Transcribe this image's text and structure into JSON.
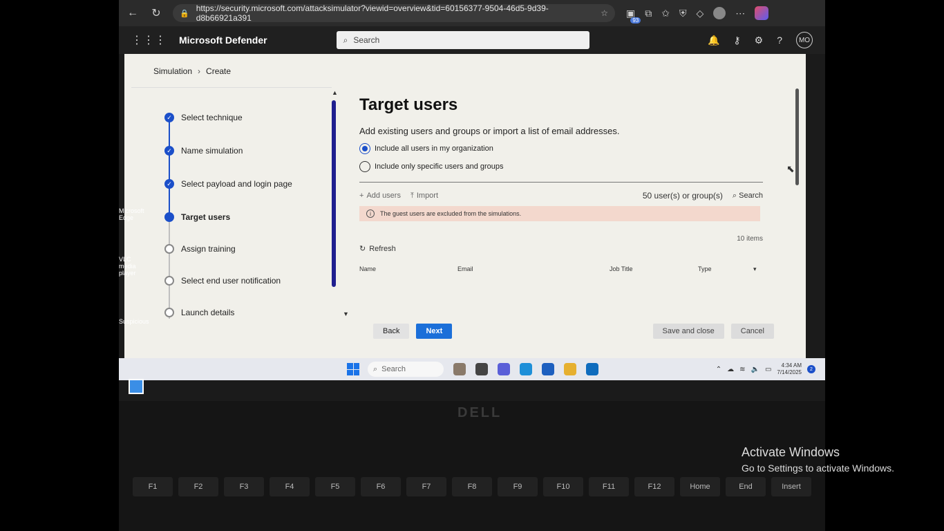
{
  "browser": {
    "url": "https://security.microsoft.com/attacksimulator?viewid=overview&tid=60156377-9504-46d5-9d39-d8b66921a391",
    "ext_badge": "93"
  },
  "header": {
    "app_title": "Microsoft Defender",
    "search_placeholder": "Search",
    "avatar_initials": "MO"
  },
  "breadcrumb": {
    "items": [
      "Simulation",
      "Create"
    ]
  },
  "steps": [
    {
      "label": "Select technique",
      "state": "done"
    },
    {
      "label": "Name simulation",
      "state": "done"
    },
    {
      "label": "Select payload and login page",
      "state": "done"
    },
    {
      "label": "Target users",
      "state": "current"
    },
    {
      "label": "Assign training",
      "state": "todo"
    },
    {
      "label": "Select end user notification",
      "state": "todo"
    },
    {
      "label": "Launch details",
      "state": "todo"
    }
  ],
  "main": {
    "title": "Target users",
    "description": "Add existing users and groups or import a list of email addresses.",
    "radio_all": "Include all users in my organization",
    "radio_specific": "Include only specific users and groups",
    "add_users": "Add users",
    "import": "Import",
    "user_count": "50 user(s) or group(s)",
    "search": "Search",
    "banner": "The guest users are excluded from the simulations.",
    "items_count": "10 items",
    "refresh": "Refresh",
    "columns": [
      "Name",
      "Email",
      "Job Title",
      "Type"
    ]
  },
  "footer": {
    "back": "Back",
    "next": "Next",
    "save_close": "Save and close",
    "cancel": "Cancel"
  },
  "taskbar": {
    "search": "Search",
    "time": "4:34 AM",
    "date": "7/14/2025",
    "notif": "2"
  },
  "desktop": {
    "icons": [
      "Microsoft Edge",
      "VLC media player",
      "Suspicious"
    ]
  },
  "watermark": {
    "line1": "Activate Windows",
    "line2": "Go to Settings to activate Windows."
  },
  "keyboard": {
    "brand": "DELL",
    "keys": [
      "F1",
      "F2",
      "F3",
      "F4",
      "F5",
      "F6",
      "F7",
      "F8",
      "F9",
      "F10",
      "F11",
      "F12",
      "Home",
      "End",
      "Insert"
    ]
  }
}
